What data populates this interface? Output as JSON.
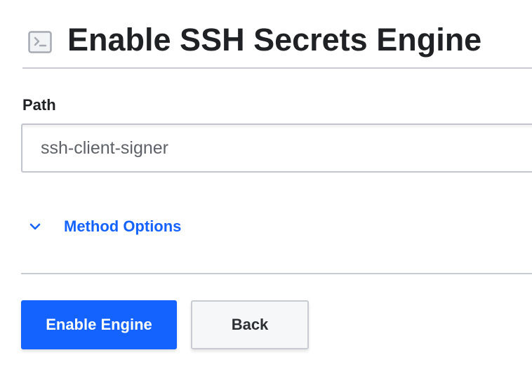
{
  "header": {
    "icon": "terminal-icon",
    "title": "Enable SSH Secrets Engine"
  },
  "form": {
    "path_label": "Path",
    "path_value": "ssh-client-signer",
    "method_options": {
      "icon": "chevron-down-icon",
      "label": "Method Options"
    }
  },
  "actions": {
    "enable_label": "Enable Engine",
    "back_label": "Back"
  },
  "colors": {
    "accent": "#1563ff",
    "text": "#1f2124",
    "border": "#c8cbd1"
  }
}
